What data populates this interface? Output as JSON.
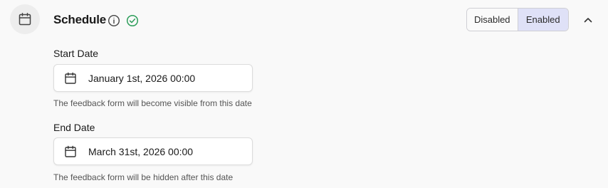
{
  "section": {
    "title": "Schedule",
    "icon": "calendar-icon",
    "info_icon": "info-icon",
    "status_icon": "check-circle-icon",
    "status_color": "#2e9e5b"
  },
  "toggle": {
    "disabled_label": "Disabled",
    "enabled_label": "Enabled",
    "selected": "Enabled",
    "selected_color": "#dfe1f7"
  },
  "collapse_icon": "chevron-up-icon",
  "start": {
    "label": "Start Date",
    "value": "January 1st, 2026 00:00",
    "helper": "The feedback form will become visible from this date"
  },
  "end": {
    "label": "End Date",
    "value": "March 31st, 2026 00:00",
    "helper": "The feedback form will be hidden after this date"
  }
}
